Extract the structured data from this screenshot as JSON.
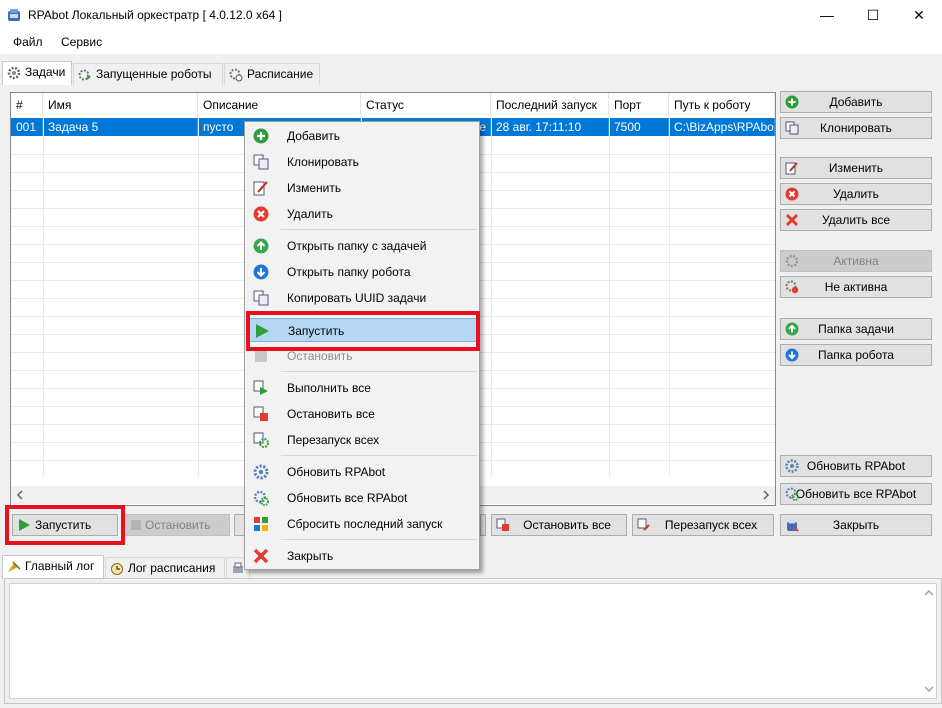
{
  "window": {
    "title": "RPAbot Локальный оркестратр [ 4.0.12.0 x64 ]",
    "minimize": "—",
    "maximize": "☐",
    "close": "✕"
  },
  "menubar": {
    "file": "Файл",
    "service": "Сервис"
  },
  "tabs_top": [
    "Задачи",
    "Запущенные роботы",
    "Расписание"
  ],
  "grid": {
    "columns": [
      "#",
      "Имя",
      "Описание",
      "Статус",
      "Последний запуск",
      "Порт",
      "Путь к роботу"
    ],
    "row": {
      "num": "001",
      "name": "Задача 5",
      "desc": "пусто",
      "status": "е",
      "last_run": "28 авг. 17:11:10",
      "port": "7500",
      "path": "C:\\BizApps\\RPAbot"
    }
  },
  "right_buttons": {
    "add": "Добавить",
    "clone": "Клонировать",
    "edit": "Изменить",
    "delete": "Удалить",
    "delete_all": "Удалить все",
    "active": "Активна",
    "inactive": "Не активна",
    "task_folder": "Папка задачи",
    "robot_folder": "Папка робота",
    "update": "Обновить RPAbot",
    "update_all": "Обновить все RPAbot",
    "close": "Закрыть"
  },
  "bottom_buttons": {
    "run": "Запустить",
    "stop": "Остановить",
    "stop_all": "Остановить все",
    "restart_all": "Перезапуск всех"
  },
  "tabs_log": [
    "Главный лог",
    "Лог расписания"
  ],
  "context_menu": {
    "add": "Добавить",
    "clone": "Клонировать",
    "edit": "Изменить",
    "delete": "Удалить",
    "open_task_folder": "Открыть папку с задачей",
    "open_robot_folder": "Открыть папку робота",
    "copy_uuid": "Копировать UUID задачи",
    "run": "Запустить",
    "stop": "Остановить",
    "run_all": "Выполнить все",
    "stop_all": "Остановить все",
    "restart_all": "Перезапуск всех",
    "update": "Обновить RPAbot",
    "update_all": "Обновить все RPAbot",
    "reset_last_run": "Сбросить последний запуск",
    "close": "Закрыть"
  },
  "colors": {
    "selection": "#0078d7",
    "highlight": "#e8101e",
    "menu_hover": "#b5d7f3"
  }
}
